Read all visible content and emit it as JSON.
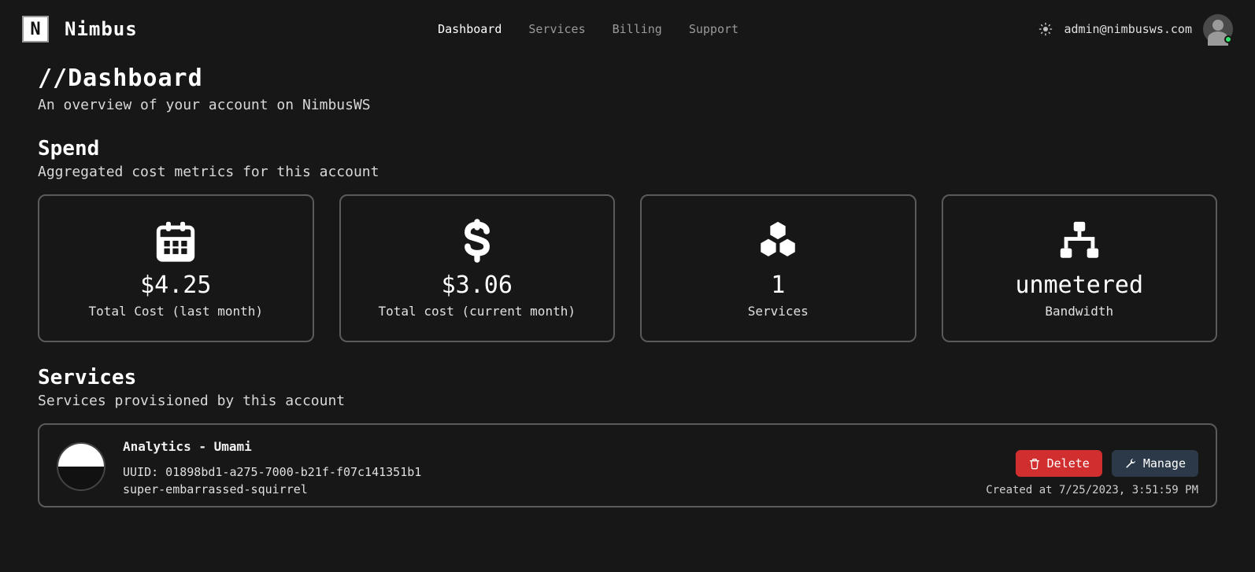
{
  "brand": "Nimbus",
  "nav": {
    "dashboard": "Dashboard",
    "services": "Services",
    "billing": "Billing",
    "support": "Support"
  },
  "user": {
    "email": "admin@nimbusws.com"
  },
  "page": {
    "title": "//Dashboard",
    "subtitle": "An overview of your account on NimbusWS"
  },
  "spend": {
    "title": "Spend",
    "subtitle": "Aggregated cost metrics for this account",
    "cards": {
      "last_month": {
        "value": "$4.25",
        "label": "Total Cost (last month)"
      },
      "current_month": {
        "value": "$3.06",
        "label": "Total cost (current month)"
      },
      "services": {
        "value": "1",
        "label": "Services"
      },
      "bandwidth": {
        "value": "unmetered",
        "label": "Bandwidth"
      }
    }
  },
  "services_section": {
    "title": "Services",
    "subtitle": "Services provisioned by this account"
  },
  "service": {
    "name": "Analytics - Umami",
    "uuid_line": "UUID: 01898bd1-a275-7000-b21f-f07c141351b1",
    "slug": "super-embarrassed-squirrel",
    "delete_label": "Delete",
    "manage_label": "Manage",
    "created_line": "Created at 7/25/2023, 3:51:59 PM"
  }
}
